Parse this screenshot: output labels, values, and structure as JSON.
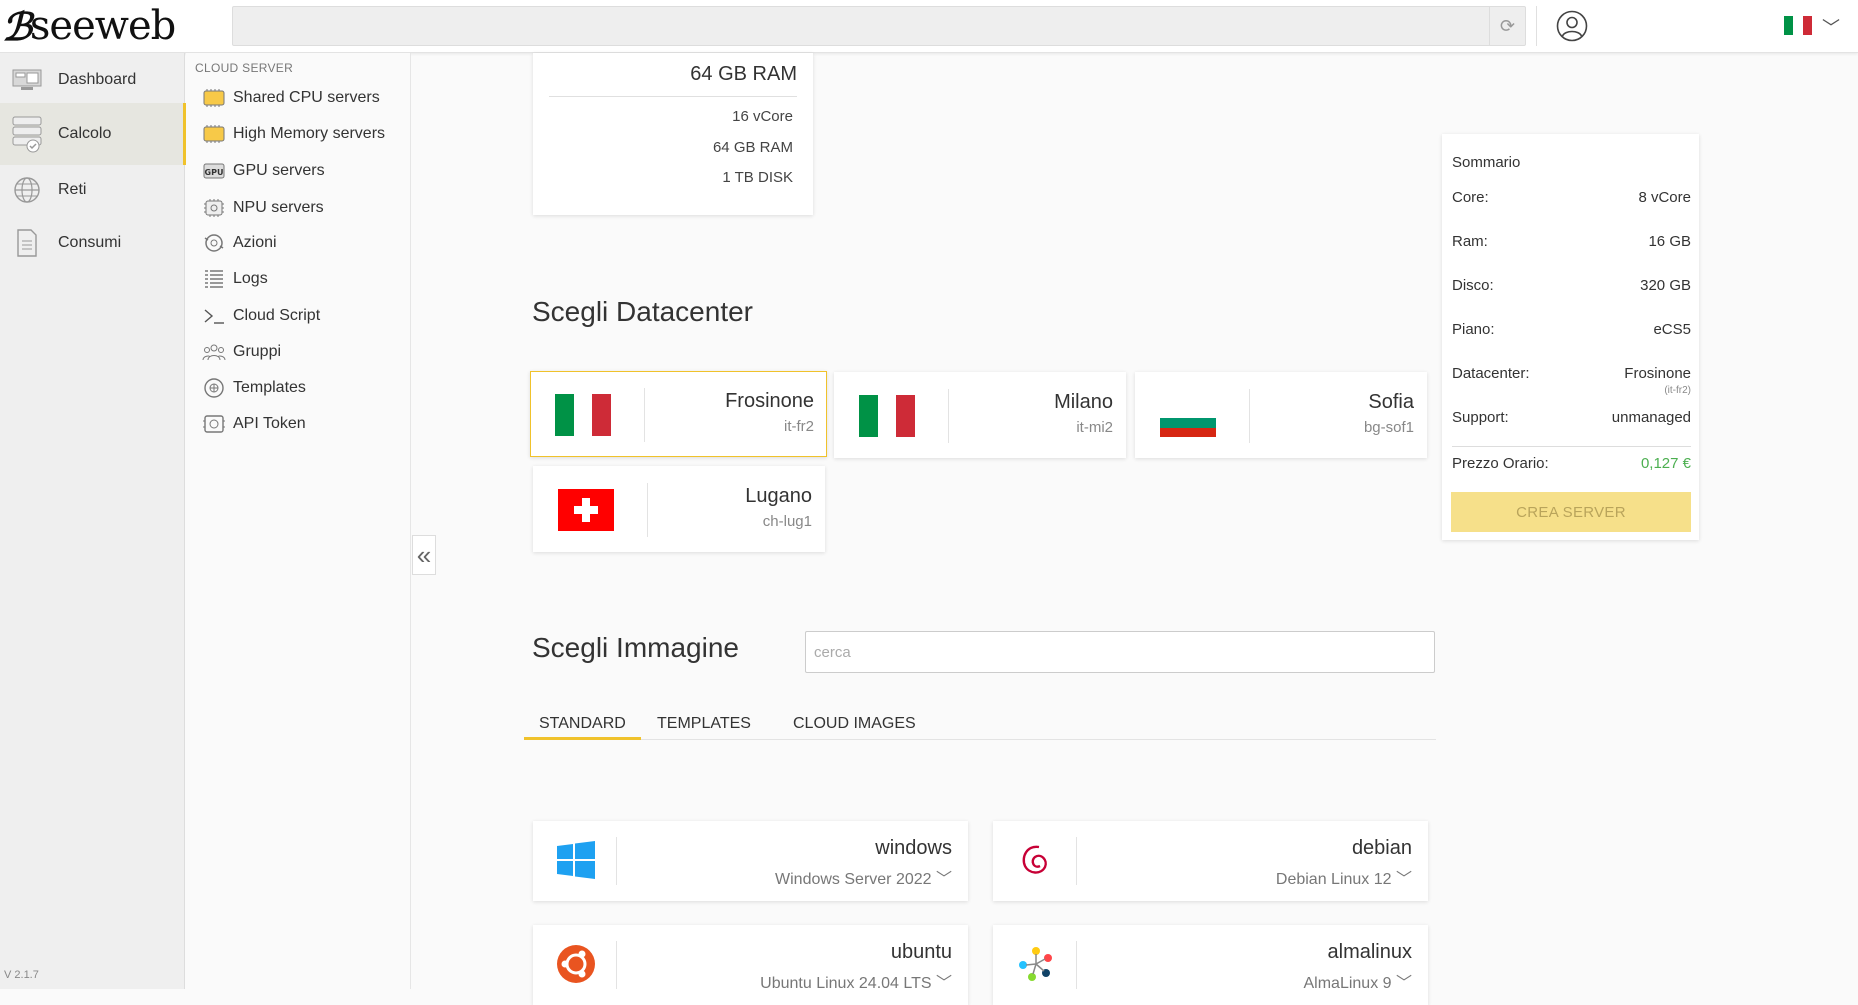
{
  "header": {
    "logo": "seeweb",
    "language": "it"
  },
  "sidebar": {
    "items": [
      {
        "label": "Dashboard",
        "icon": "dashboard-icon"
      },
      {
        "label": "Calcolo",
        "icon": "server-stack-icon",
        "active": true
      },
      {
        "label": "Reti",
        "icon": "globe-icon"
      },
      {
        "label": "Consumi",
        "icon": "document-icon"
      }
    ],
    "version": "V 2.1.7"
  },
  "submenu": {
    "header": "CLOUD SERVER",
    "items": [
      {
        "label": "Shared CPU servers",
        "icon": "cpu-chip-icon"
      },
      {
        "label": "High Memory servers",
        "icon": "memory-chip-icon"
      },
      {
        "label": "GPU servers",
        "icon": "gpu-icon"
      },
      {
        "label": "NPU servers",
        "icon": "npu-icon"
      },
      {
        "label": "Azioni",
        "icon": "actions-icon"
      },
      {
        "label": "Logs",
        "icon": "logs-icon"
      },
      {
        "label": "Cloud Script",
        "icon": "terminal-icon"
      },
      {
        "label": "Gruppi",
        "icon": "group-icon"
      },
      {
        "label": "Templates",
        "icon": "templates-icon"
      },
      {
        "label": "API Token",
        "icon": "api-token-icon"
      }
    ]
  },
  "plan": {
    "title": "64 GB RAM",
    "specs": [
      "16 vCore",
      "64 GB RAM",
      "1 TB DISK"
    ]
  },
  "datacenter": {
    "title": "Scegli Datacenter",
    "options": [
      {
        "name": "Frosinone",
        "code": "it-fr2",
        "flag": "italy",
        "selected": true
      },
      {
        "name": "Milano",
        "code": "it-mi2",
        "flag": "italy"
      },
      {
        "name": "Sofia",
        "code": "bg-sof1",
        "flag": "bulgaria"
      },
      {
        "name": "Lugano",
        "code": "ch-lug1",
        "flag": "switzerland"
      }
    ]
  },
  "image": {
    "title": "Scegli Immagine",
    "search_placeholder": "cerca",
    "tabs": [
      "STANDARD",
      "TEMPLATES",
      "CLOUD IMAGES"
    ],
    "active_tab": "STANDARD",
    "os": [
      {
        "name": "windows",
        "version": "Windows Server 2022",
        "icon": "windows-logo-icon"
      },
      {
        "name": "debian",
        "version": "Debian Linux 12",
        "icon": "debian-logo-icon"
      },
      {
        "name": "ubuntu",
        "version": "Ubuntu Linux 24.04 LTS",
        "icon": "ubuntu-logo-icon"
      },
      {
        "name": "almalinux",
        "version": "AlmaLinux 9",
        "icon": "almalinux-logo-icon"
      }
    ]
  },
  "summary": {
    "title": "Sommario",
    "rows": [
      {
        "key": "Core:",
        "value": "8 vCore"
      },
      {
        "key": "Ram:",
        "value": "16 GB"
      },
      {
        "key": "Disco:",
        "value": "320 GB"
      },
      {
        "key": "Piano:",
        "value": "eCS5"
      },
      {
        "key": "Datacenter:",
        "value": "Frosinone"
      },
      {
        "key": "Support:",
        "value": "unmanaged"
      }
    ],
    "datacenter_sub": "(it-fr2)",
    "price_label": "Prezzo Orario:",
    "price_value": "0,127 €",
    "create_label": "CREA SERVER"
  },
  "colors": {
    "accent": "#f0c22b",
    "price": "#4caf50",
    "button_disabled": "#f6e08a"
  }
}
